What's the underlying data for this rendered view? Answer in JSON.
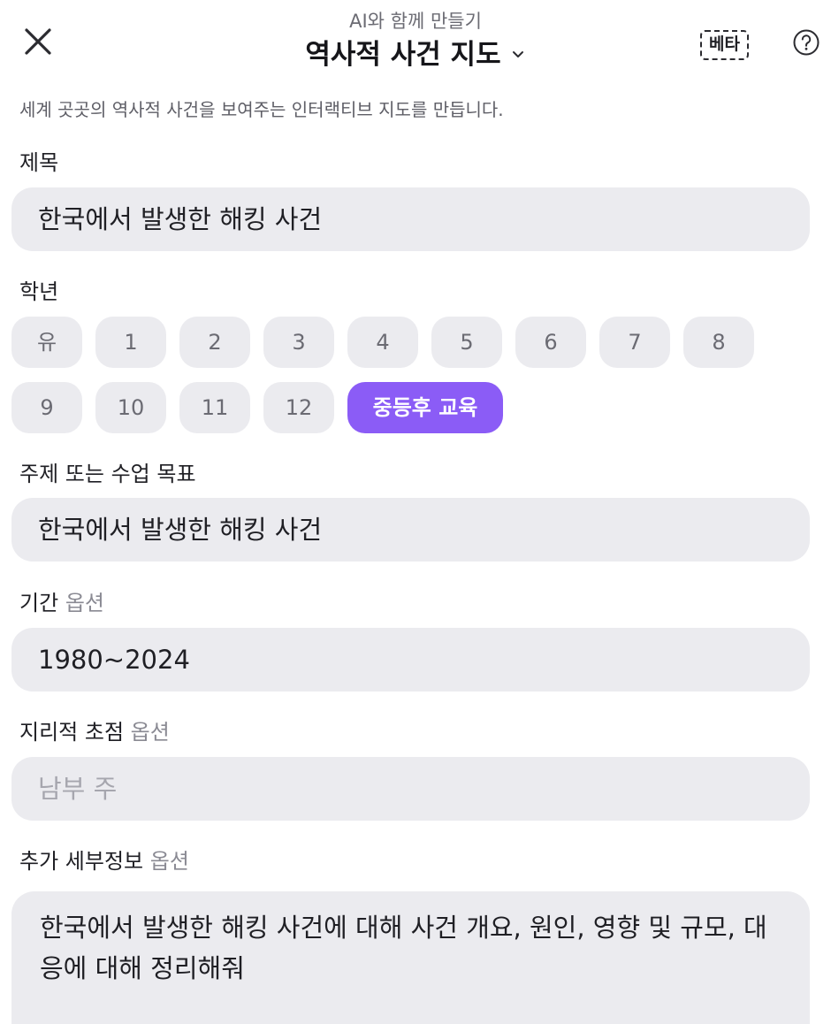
{
  "header": {
    "subtitle": "AI와 함께 만들기",
    "title": "역사적 사건 지도",
    "beta_label": "베타",
    "description": "세계 곳곳의 역사적 사건을 보여주는 인터랙티브 지도를 만듭니다."
  },
  "form": {
    "title_label": "제목",
    "title_value": "한국에서 발생한 해킹 사건",
    "grade_label": "학년",
    "grades": [
      "유",
      "1",
      "2",
      "3",
      "4",
      "5",
      "6",
      "7",
      "8",
      "9",
      "10",
      "11",
      "12",
      "중등후 교육"
    ],
    "selected_grade": "중등후 교육",
    "topic_label": "주제 또는 수업 목표",
    "topic_value": "한국에서 발생한 해킹 사건",
    "period_label": "기간",
    "period_optional": "옵션",
    "period_value": "1980~2024",
    "geo_label": "지리적 초점",
    "geo_optional": "옵션",
    "geo_placeholder": "남부 주",
    "details_label": "추가 세부정보",
    "details_optional": "옵션",
    "details_value": "한국에서 발생한 해킹 사건에 대해 사건 개요, 원인, 영향 및 규모, 대응에 대해 정리해줘"
  },
  "colors": {
    "accent": "#8b5cf6",
    "field_bg": "#ebebef",
    "muted_text": "#8a8a93"
  },
  "icons": {
    "close": "close-icon",
    "dropdown": "chevron-down-icon",
    "help": "help-circle-icon"
  }
}
